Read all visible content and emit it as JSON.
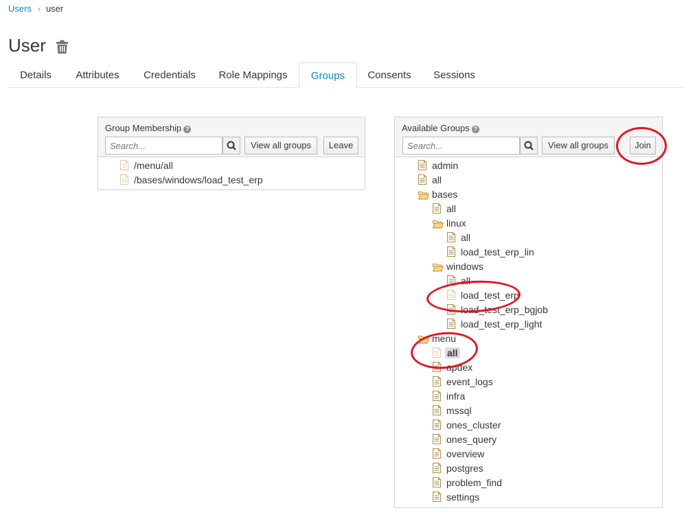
{
  "breadcrumb": {
    "parent": "Users",
    "separator": "›",
    "current": "user"
  },
  "page": {
    "title": "User",
    "delete_icon": "trash-icon"
  },
  "tabs": [
    {
      "label": "Details"
    },
    {
      "label": "Attributes"
    },
    {
      "label": "Credentials"
    },
    {
      "label": "Role Mappings"
    },
    {
      "label": "Groups",
      "active": true
    },
    {
      "label": "Consents"
    },
    {
      "label": "Sessions"
    }
  ],
  "membership": {
    "title": "Group Membership",
    "search_placeholder": "Search...",
    "view_all_label": "View all groups",
    "leave_label": "Leave",
    "items": [
      "/menu/all",
      "/bases/windows/load_test_erp"
    ]
  },
  "available": {
    "title": "Available Groups",
    "search_placeholder": "Search...",
    "view_all_label": "View all groups",
    "join_label": "Join",
    "tree": [
      {
        "label": "admin",
        "type": "file"
      },
      {
        "label": "all",
        "type": "file"
      },
      {
        "label": "bases",
        "type": "folder"
      },
      {
        "label": "all",
        "type": "file"
      },
      {
        "label": "linux",
        "type": "folder"
      },
      {
        "label": "all",
        "type": "file"
      },
      {
        "label": "load_test_erp_lin",
        "type": "file"
      },
      {
        "label": "windows",
        "type": "folder"
      },
      {
        "label": "all",
        "type": "file"
      },
      {
        "label": "load_test_erp",
        "type": "file",
        "member": true
      },
      {
        "label": "load_test_erp_bgjob",
        "type": "file"
      },
      {
        "label": "load_test_erp_light",
        "type": "file"
      },
      {
        "label": "menu",
        "type": "folder"
      },
      {
        "label": "all",
        "type": "file",
        "member": true,
        "selected": true
      },
      {
        "label": "apdex",
        "type": "file"
      },
      {
        "label": "event_logs",
        "type": "file"
      },
      {
        "label": "infra",
        "type": "file"
      },
      {
        "label": "mssql",
        "type": "file"
      },
      {
        "label": "ones_cluster",
        "type": "file"
      },
      {
        "label": "ones_query",
        "type": "file"
      },
      {
        "label": "overview",
        "type": "file"
      },
      {
        "label": "postgres",
        "type": "file"
      },
      {
        "label": "problem_find",
        "type": "file"
      },
      {
        "label": "settings",
        "type": "file"
      }
    ]
  },
  "colors": {
    "link": "#0088ce",
    "annotation": "#e2161f",
    "folder": "#e8a33d"
  }
}
